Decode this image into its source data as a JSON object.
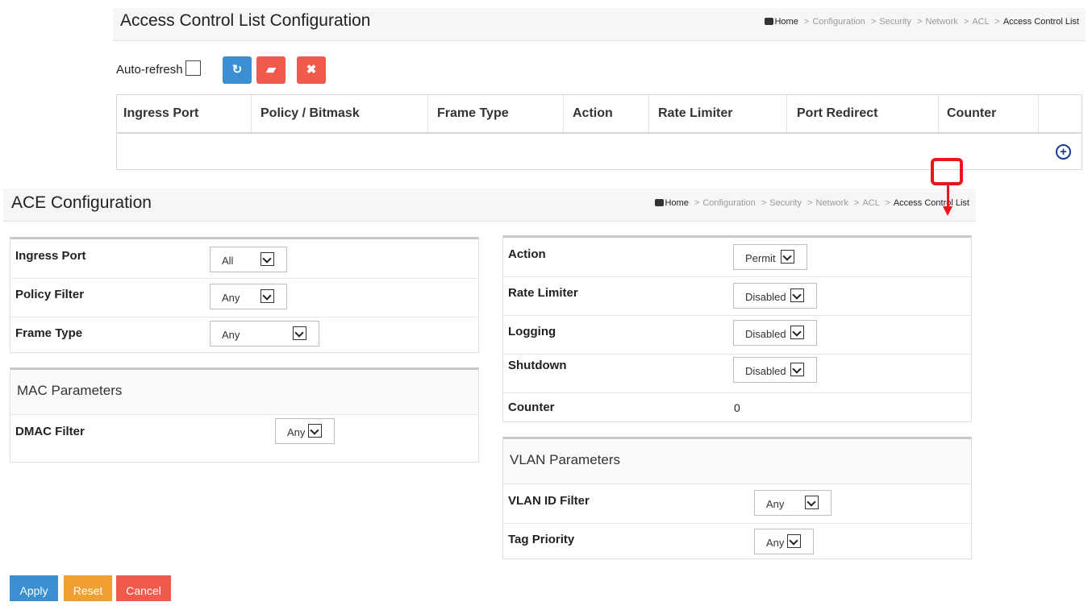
{
  "acl": {
    "title": "Access Control List Configuration",
    "breadcrumb": {
      "home": "Home",
      "items": [
        "Configuration",
        "Security",
        "Network",
        "ACL"
      ],
      "current": "Access Control List"
    },
    "autorefresh_label": "Auto-refresh",
    "toolbar": {
      "refresh_icon": "refresh-icon",
      "eraser_icon": "eraser-icon",
      "close_icon": "close-icon"
    },
    "columns": [
      "Ingress Port",
      "Policy / Bitmask",
      "Frame Type",
      "Action",
      "Rate Limiter",
      "Port Redirect",
      "Counter"
    ],
    "add_icon": "plus-circle-icon"
  },
  "ace": {
    "title": "ACE Configuration",
    "breadcrumb": {
      "home": "Home",
      "items": [
        "Configuration",
        "Security",
        "Network",
        "ACL"
      ],
      "current": "Access Control List"
    },
    "left": {
      "ingress_port": {
        "label": "Ingress Port",
        "value": "All"
      },
      "policy_filter": {
        "label": "Policy Filter",
        "value": "Any"
      },
      "frame_type": {
        "label": "Frame Type",
        "value": "Any"
      }
    },
    "mac": {
      "title": "MAC Parameters",
      "dmac_filter": {
        "label": "DMAC Filter",
        "value": "Any"
      }
    },
    "right": {
      "action": {
        "label": "Action",
        "value": "Permit"
      },
      "rate_limiter": {
        "label": "Rate Limiter",
        "value": "Disabled"
      },
      "logging": {
        "label": "Logging",
        "value": "Disabled"
      },
      "shutdown": {
        "label": "Shutdown",
        "value": "Disabled"
      },
      "counter": {
        "label": "Counter",
        "value": "0"
      }
    },
    "vlan": {
      "title": "VLAN Parameters",
      "vlan_id_filter": {
        "label": "VLAN ID Filter",
        "value": "Any"
      },
      "tag_priority": {
        "label": "Tag Priority",
        "value": "Any"
      }
    },
    "buttons": {
      "apply": "Apply",
      "reset": "Reset",
      "cancel": "Cancel"
    }
  },
  "colors": {
    "blue_button": "#3a8fd0",
    "red_button": "#ef5a4d",
    "orange_button": "#f0a030",
    "annotation": "#e8151b"
  }
}
